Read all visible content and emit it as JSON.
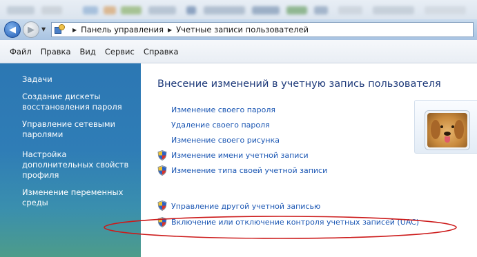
{
  "address_bar": {
    "breadcrumbs": [
      "Панель управления",
      "Учетные записи пользователей"
    ]
  },
  "menu": {
    "items": [
      "Файл",
      "Правка",
      "Вид",
      "Сервис",
      "Справка"
    ]
  },
  "sidebar": {
    "heading": "Задачи",
    "links": [
      "Создание дискеты восстановления пароля",
      "Управление сетевыми паролями",
      "Настройка дополнительных свойств профиля",
      "Изменение переменных среды"
    ]
  },
  "main": {
    "title": "Внесение изменений в учетную запись пользователя",
    "tasks": [
      {
        "label": "Изменение своего пароля",
        "shield": false
      },
      {
        "label": "Удаление своего пароля",
        "shield": false
      },
      {
        "label": "Изменение своего рисунка",
        "shield": false
      },
      {
        "label": "Изменение имени учетной записи",
        "shield": true
      },
      {
        "label": "Изменение типа своей учетной записи",
        "shield": true
      }
    ],
    "other_tasks": [
      {
        "label": "Управление другой учетной записью",
        "shield": true
      },
      {
        "label": "Включение или отключение контроля учетных записей (UAC)",
        "shield": true
      }
    ]
  },
  "colors": {
    "link": "#1a56b3",
    "title": "#1e3a7a",
    "sidebar": "#2f7db6",
    "annotation": "#cc1a1a"
  }
}
